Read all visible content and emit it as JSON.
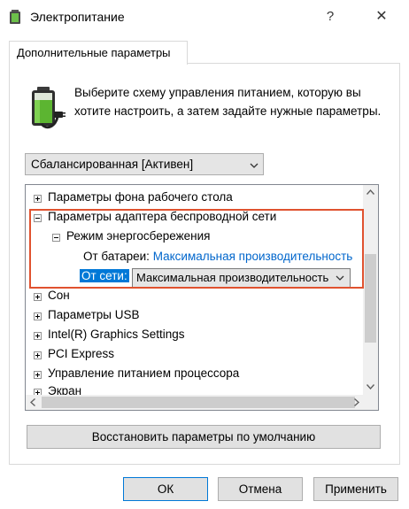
{
  "window": {
    "title": "Электропитание",
    "help": "?",
    "close": "✕"
  },
  "tab": {
    "label": "Дополнительные параметры"
  },
  "description": "Выберите схему управления питанием, которую вы хотите настроить, а затем задайте нужные параметры.",
  "scheme_select": {
    "value": "Сбалансированная [Активен]"
  },
  "tree": {
    "items": [
      {
        "label": "Параметры фона рабочего стола"
      },
      {
        "label": "Параметры адаптера беспроводной сети"
      },
      {
        "label": "Режим энергосбережения"
      },
      {
        "label": "От батареи:",
        "value": "Максимальная производительность"
      },
      {
        "label": "От сети:",
        "value": "Максимальная производительность"
      },
      {
        "label": "Сон"
      },
      {
        "label": "Параметры USB"
      },
      {
        "label": "Intel(R) Graphics Settings"
      },
      {
        "label": "PCI Express"
      },
      {
        "label": "Управление питанием процессора"
      },
      {
        "label": "Экран"
      }
    ]
  },
  "buttons": {
    "restore": "Восстановить параметры по умолчанию",
    "ok": "ОК",
    "cancel": "Отмена",
    "apply": "Применить"
  },
  "colors": {
    "highlight": "#e0522f",
    "selection": "#0078d7",
    "link": "#0066cc"
  }
}
